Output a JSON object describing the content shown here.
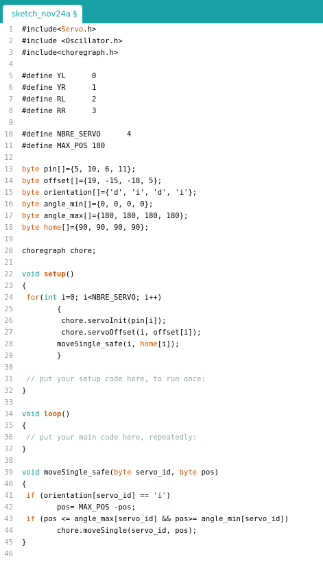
{
  "tab": {
    "label": "sketch_nov24a §"
  },
  "lines": [
    [
      {
        "t": "#include<"
      },
      {
        "t": "Servo",
        "c": "kw"
      },
      {
        "t": ".h>"
      }
    ],
    [
      {
        "t": "#include <Oscillator.h>"
      }
    ],
    [
      {
        "t": "#include<choregraph.h>"
      }
    ],
    [],
    [
      {
        "t": "#define YL      0"
      }
    ],
    [
      {
        "t": "#define YR      1"
      }
    ],
    [
      {
        "t": "#define RL      2"
      }
    ],
    [
      {
        "t": "#define RR      3"
      }
    ],
    [],
    [
      {
        "t": "#define NBRE_SERVO      4"
      }
    ],
    [
      {
        "t": "#define MAX_POS 180"
      }
    ],
    [],
    [
      {
        "t": "byte",
        "c": "kw"
      },
      {
        "t": " pin[]={5, 10, 6, 11};"
      }
    ],
    [
      {
        "t": "byte",
        "c": "kw"
      },
      {
        "t": " offset[]={19, -15, -18, 5};"
      }
    ],
    [
      {
        "t": "byte",
        "c": "kw"
      },
      {
        "t": " orientation[]={'d', 'i', 'd', 'i'};"
      }
    ],
    [
      {
        "t": "byte",
        "c": "kw"
      },
      {
        "t": " angle_min[]={0, 0, 0, 0};"
      }
    ],
    [
      {
        "t": "byte",
        "c": "kw"
      },
      {
        "t": " angle_max[]={180, 180, 180, 180};"
      }
    ],
    [
      {
        "t": "byte",
        "c": "kw"
      },
      {
        "t": " "
      },
      {
        "t": "home",
        "c": "kw"
      },
      {
        "t": "[]={90, 90, 90, 90};"
      }
    ],
    [],
    [
      {
        "t": "choregraph chore;"
      }
    ],
    [],
    [
      {
        "t": "void",
        "c": "type"
      },
      {
        "t": " "
      },
      {
        "t": "setup",
        "c": "fn"
      },
      {
        "t": "()"
      }
    ],
    [
      {
        "t": "{"
      }
    ],
    [
      {
        "t": " "
      },
      {
        "t": "for",
        "c": "kw"
      },
      {
        "t": "("
      },
      {
        "t": "int",
        "c": "type"
      },
      {
        "t": " i=0; i<NBRE_SERVO; i++)"
      }
    ],
    [
      {
        "t": "        {"
      }
    ],
    [
      {
        "t": "         chore.servoInit(pin[i]);"
      }
    ],
    [
      {
        "t": "         chore.servoOffset(i, offset[i]);"
      }
    ],
    [
      {
        "t": "        moveSingle_safe(i, "
      },
      {
        "t": "home",
        "c": "kw"
      },
      {
        "t": "[i]);"
      }
    ],
    [
      {
        "t": "        }"
      }
    ],
    [],
    [
      {
        "t": " // put your setup code here, to run once:",
        "c": "comment"
      }
    ],
    [
      {
        "t": "}"
      }
    ],
    [],
    [
      {
        "t": "void",
        "c": "type"
      },
      {
        "t": " "
      },
      {
        "t": "loop",
        "c": "fn"
      },
      {
        "t": "()"
      }
    ],
    [
      {
        "t": "{"
      }
    ],
    [
      {
        "t": " // put your main code here, repeatedly:",
        "c": "comment"
      }
    ],
    [
      {
        "t": "}"
      }
    ],
    [],
    [
      {
        "t": "void",
        "c": "type"
      },
      {
        "t": " moveSingle_safe("
      },
      {
        "t": "byte",
        "c": "kw"
      },
      {
        "t": " servo_id, "
      },
      {
        "t": "byte",
        "c": "kw"
      },
      {
        "t": " pos)"
      }
    ],
    [
      {
        "t": "{"
      }
    ],
    [
      {
        "t": " "
      },
      {
        "t": "if",
        "c": "kw"
      },
      {
        "t": " (orientation[servo_id] == "
      },
      {
        "t": "'i'",
        "c": "str"
      },
      {
        "t": ")"
      }
    ],
    [
      {
        "t": "        pos= MAX_POS -pos;"
      }
    ],
    [
      {
        "t": " "
      },
      {
        "t": "if",
        "c": "kw"
      },
      {
        "t": " (pos <= angle_max[servo_id] && pos>= angle_min[servo_id])"
      }
    ],
    [
      {
        "t": "        chore.moveSingle(servo_id, pos);"
      }
    ],
    [
      {
        "t": "}"
      }
    ],
    []
  ]
}
